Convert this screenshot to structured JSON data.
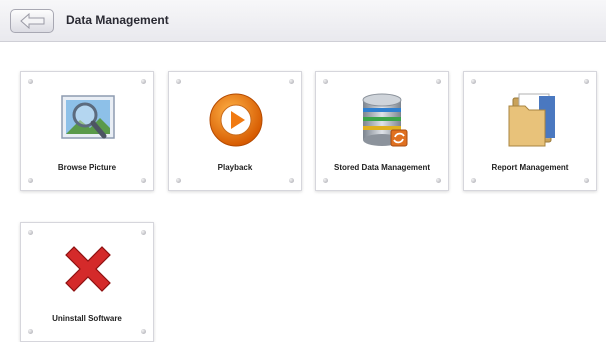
{
  "header": {
    "title": "Data Management",
    "back_icon": "back-arrow-icon"
  },
  "tiles": [
    {
      "label": "Browse Picture",
      "icon": "picture-magnifier-icon"
    },
    {
      "label": "Playback",
      "icon": "play-icon"
    },
    {
      "label": "Stored Data Management",
      "icon": "database-icon"
    },
    {
      "label": "Report Management",
      "icon": "folder-icon"
    },
    {
      "label": "Uninstall Software",
      "icon": "red-x-icon"
    }
  ]
}
